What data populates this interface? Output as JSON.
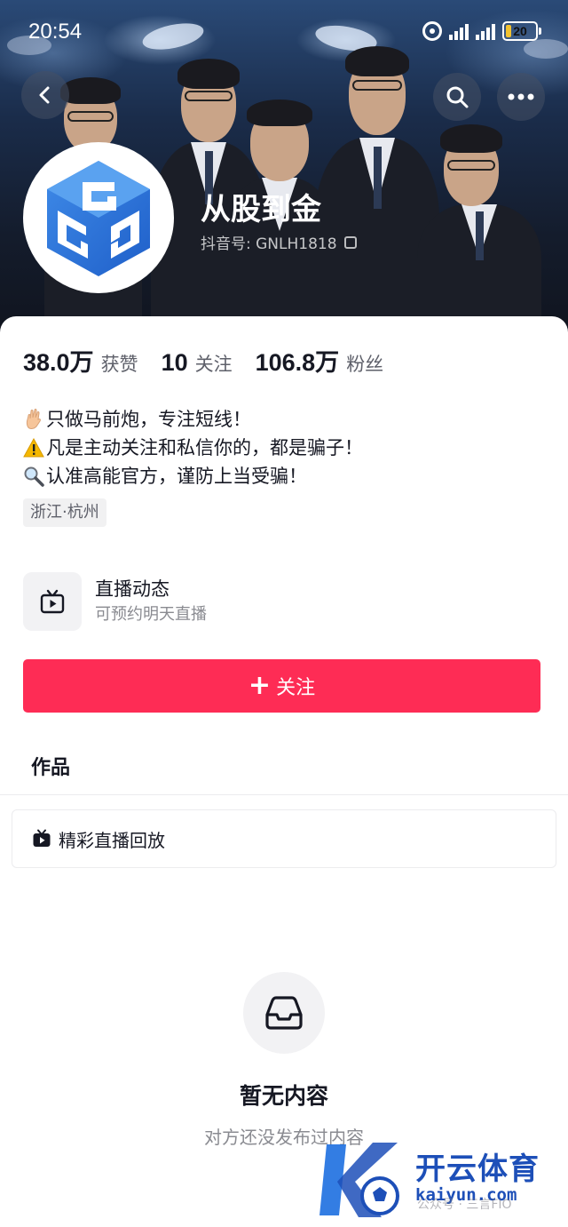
{
  "status_bar": {
    "time": "20:54",
    "battery": "20",
    "battery_level": 0.2
  },
  "header": {
    "back_icon": "chevron-left-icon",
    "search_icon": "search-icon",
    "more_icon": "more-horizontal-icon"
  },
  "profile": {
    "name": "从股到金",
    "douyin_id": "抖音号: GNLH1818",
    "avatar_icon": "gg-logo-icon"
  },
  "stats": [
    {
      "value": "38.0万",
      "label": "获赞"
    },
    {
      "value": "10",
      "label": "关注"
    },
    {
      "value": "106.8万",
      "label": "粉丝"
    }
  ],
  "bio": [
    {
      "emoji": "hand-icon",
      "text": "只做马前炮，专注短线！"
    },
    {
      "emoji": "warning-icon",
      "text": "凡是主动关注和私信你的，都是骗子！"
    },
    {
      "emoji": "magnifier-icon",
      "text": "认准高能官方，谨防上当受骗！"
    }
  ],
  "location": "浙江·杭州",
  "live": {
    "title": "直播动态",
    "subtitle": "可预约明天直播"
  },
  "follow_button": {
    "plus": "+",
    "label": "关注"
  },
  "tabs": {
    "works": "作品"
  },
  "replay": {
    "label": "精彩直播回放"
  },
  "empty": {
    "title": "暂无内容",
    "subtitle": "对方还没发布过内容"
  },
  "watermark": {
    "source": "公众号 · 三言FIO",
    "brand": "开云体育",
    "url": "kaiyun.com"
  },
  "colors": {
    "accent": "#fe2c55",
    "brand_blue": "#1d4fb8"
  }
}
